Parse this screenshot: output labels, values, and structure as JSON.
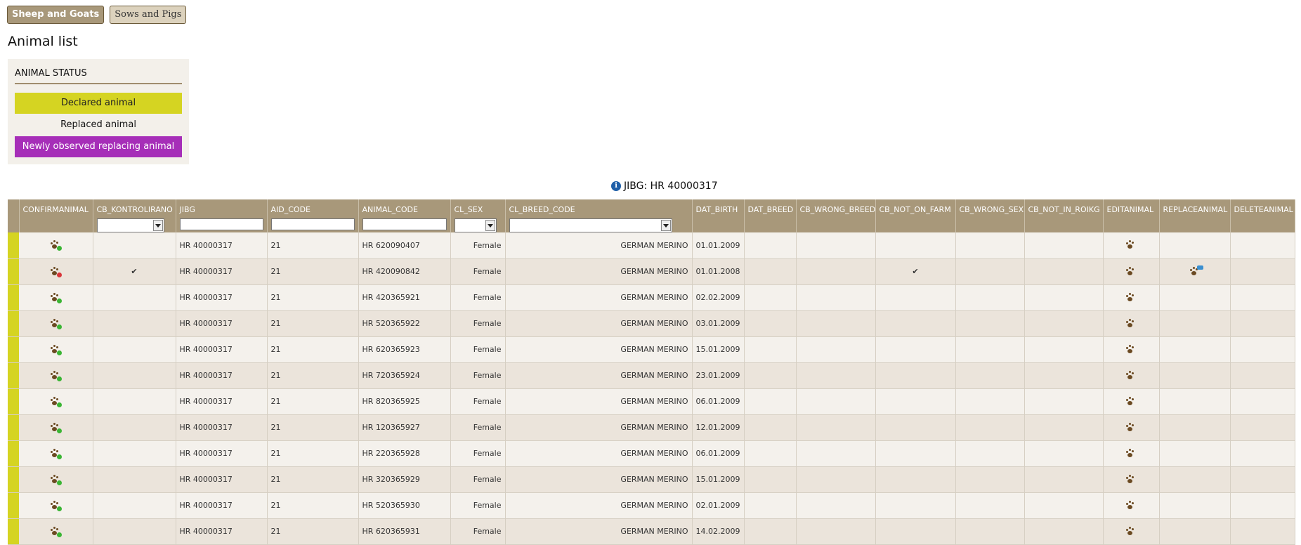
{
  "tabs": {
    "sheep_goats": "Sheep and Goats",
    "sows_pigs": "Sows and Pigs"
  },
  "page_title": "Animal list",
  "animal_status": {
    "heading": "ANIMAL STATUS",
    "declared": "Declared animal",
    "replaced": "Replaced animal",
    "newly_observed": "Newly observed replacing animal",
    "colors": {
      "declared": "#d5d422",
      "newly_observed": "#a62eb8"
    }
  },
  "jibg_info": "JIBG: HR 40000317",
  "columns": {
    "confirmanimal": "CONFIRMANIMAL",
    "cb_kontrolirano": "CB_KONTROLIRANO",
    "jibg": "JIBG",
    "aid_code": "AID_CODE",
    "animal_code": "ANIMAL_CODE",
    "cl_sex": "CL_SEX",
    "cl_breed_code": "CL_BREED_CODE",
    "dat_birth": "DAT_BIRTH",
    "dat_breed": "DAT_BREED",
    "cb_wrong_breed": "CB_WRONG_BREED",
    "cb_not_on_farm": "CB_NOT_ON_FARM",
    "cb_wrong_sex": "CB_WRONG_SEX",
    "cb_not_in_roikg": "CB_NOT_IN_ROIKG",
    "editanimal": "EDITANIMAL",
    "replaceanimal": "REPLACEANIMAL",
    "deleteanimal": "DELETEANIMAL"
  },
  "rows": [
    {
      "jibg": "HR 40000317",
      "aid": "21",
      "code": "HR 620090407",
      "sex": "Female",
      "breed": "GERMAN MERINO",
      "birth": "01.01.2009",
      "kontrolirano": "",
      "not_on_farm": "",
      "confirm": "ok",
      "replace": false
    },
    {
      "jibg": "HR 40000317",
      "aid": "21",
      "code": "HR 420090842",
      "sex": "Female",
      "breed": "GERMAN MERINO",
      "birth": "01.01.2008",
      "kontrolirano": "✔",
      "not_on_farm": "✔",
      "confirm": "no",
      "replace": true
    },
    {
      "jibg": "HR 40000317",
      "aid": "21",
      "code": "HR 420365921",
      "sex": "Female",
      "breed": "GERMAN MERINO",
      "birth": "02.02.2009",
      "kontrolirano": "",
      "not_on_farm": "",
      "confirm": "ok",
      "replace": false
    },
    {
      "jibg": "HR 40000317",
      "aid": "21",
      "code": "HR 520365922",
      "sex": "Female",
      "breed": "GERMAN MERINO",
      "birth": "03.01.2009",
      "kontrolirano": "",
      "not_on_farm": "",
      "confirm": "ok",
      "replace": false
    },
    {
      "jibg": "HR 40000317",
      "aid": "21",
      "code": "HR 620365923",
      "sex": "Female",
      "breed": "GERMAN MERINO",
      "birth": "15.01.2009",
      "kontrolirano": "",
      "not_on_farm": "",
      "confirm": "ok",
      "replace": false
    },
    {
      "jibg": "HR 40000317",
      "aid": "21",
      "code": "HR 720365924",
      "sex": "Female",
      "breed": "GERMAN MERINO",
      "birth": "23.01.2009",
      "kontrolirano": "",
      "not_on_farm": "",
      "confirm": "ok",
      "replace": false
    },
    {
      "jibg": "HR 40000317",
      "aid": "21",
      "code": "HR 820365925",
      "sex": "Female",
      "breed": "GERMAN MERINO",
      "birth": "06.01.2009",
      "kontrolirano": "",
      "not_on_farm": "",
      "confirm": "ok",
      "replace": false
    },
    {
      "jibg": "HR 40000317",
      "aid": "21",
      "code": "HR 120365927",
      "sex": "Female",
      "breed": "GERMAN MERINO",
      "birth": "12.01.2009",
      "kontrolirano": "",
      "not_on_farm": "",
      "confirm": "ok",
      "replace": false
    },
    {
      "jibg": "HR 40000317",
      "aid": "21",
      "code": "HR 220365928",
      "sex": "Female",
      "breed": "GERMAN MERINO",
      "birth": "06.01.2009",
      "kontrolirano": "",
      "not_on_farm": "",
      "confirm": "ok",
      "replace": false
    },
    {
      "jibg": "HR 40000317",
      "aid": "21",
      "code": "HR 320365929",
      "sex": "Female",
      "breed": "GERMAN MERINO",
      "birth": "15.01.2009",
      "kontrolirano": "",
      "not_on_farm": "",
      "confirm": "ok",
      "replace": false
    },
    {
      "jibg": "HR 40000317",
      "aid": "21",
      "code": "HR 520365930",
      "sex": "Female",
      "breed": "GERMAN MERINO",
      "birth": "02.01.2009",
      "kontrolirano": "",
      "not_on_farm": "",
      "confirm": "ok",
      "replace": false
    },
    {
      "jibg": "HR 40000317",
      "aid": "21",
      "code": "HR 620365931",
      "sex": "Female",
      "breed": "GERMAN MERINO",
      "birth": "14.02.2009",
      "kontrolirano": "",
      "not_on_farm": "",
      "confirm": "ok",
      "replace": false
    }
  ],
  "icons": {
    "confirm": "paw-confirm-icon",
    "edit": "paw-edit-icon",
    "replace": "paw-replace-icon",
    "info": "info-icon"
  }
}
